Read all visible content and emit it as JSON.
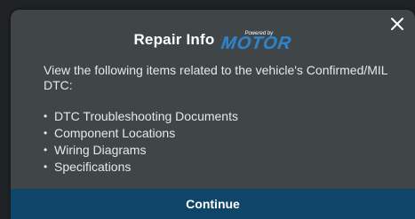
{
  "dialog": {
    "title": "Repair Info",
    "brand": {
      "powered_by": "Powered by",
      "logo_text": "MOTOR",
      "logo_color": "#2d83c9"
    },
    "close_icon": "close-icon",
    "description": "View the following items related to the vehicle's Confirmed/MIL DTC:",
    "items": [
      "DTC Troubleshooting Documents",
      "Component Locations",
      "Wiring Diagrams",
      "Specifications"
    ],
    "bullet": "•",
    "continue_label": "Continue",
    "colors": {
      "dialog_bg": "#404548",
      "button_bg": "#0e4568",
      "text": "#e6e8e9"
    }
  }
}
